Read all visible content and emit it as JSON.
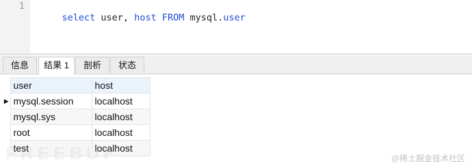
{
  "editor": {
    "line_number": "1",
    "tokens": [
      {
        "text": "select",
        "kind": "kw"
      },
      {
        "text": " user, ",
        "kind": "plain"
      },
      {
        "text": "host",
        "kind": "kw"
      },
      {
        "text": " ",
        "kind": "plain"
      },
      {
        "text": "FROM",
        "kind": "kw"
      },
      {
        "text": " mysql.",
        "kind": "plain"
      },
      {
        "text": "user",
        "kind": "ident"
      }
    ]
  },
  "tabs": [
    "信息",
    "结果 1",
    "剖析",
    "状态"
  ],
  "active_tab": "结果 1",
  "grid": {
    "columns": [
      "user",
      "host"
    ],
    "rows": [
      [
        "mysql.session",
        "localhost"
      ],
      [
        "mysql.sys",
        "localhost"
      ],
      [
        "root",
        "localhost"
      ],
      [
        "test",
        "localhost"
      ]
    ],
    "current_row_indicator": "▶"
  },
  "watermark_left": "FREEBUF",
  "watermark_right": "@稀土掘金技术社区",
  "colors": {
    "keyword": "#1f4bd6",
    "header_bg": "#eaf2fb",
    "alt_row_bg": "#f7f7f7"
  }
}
